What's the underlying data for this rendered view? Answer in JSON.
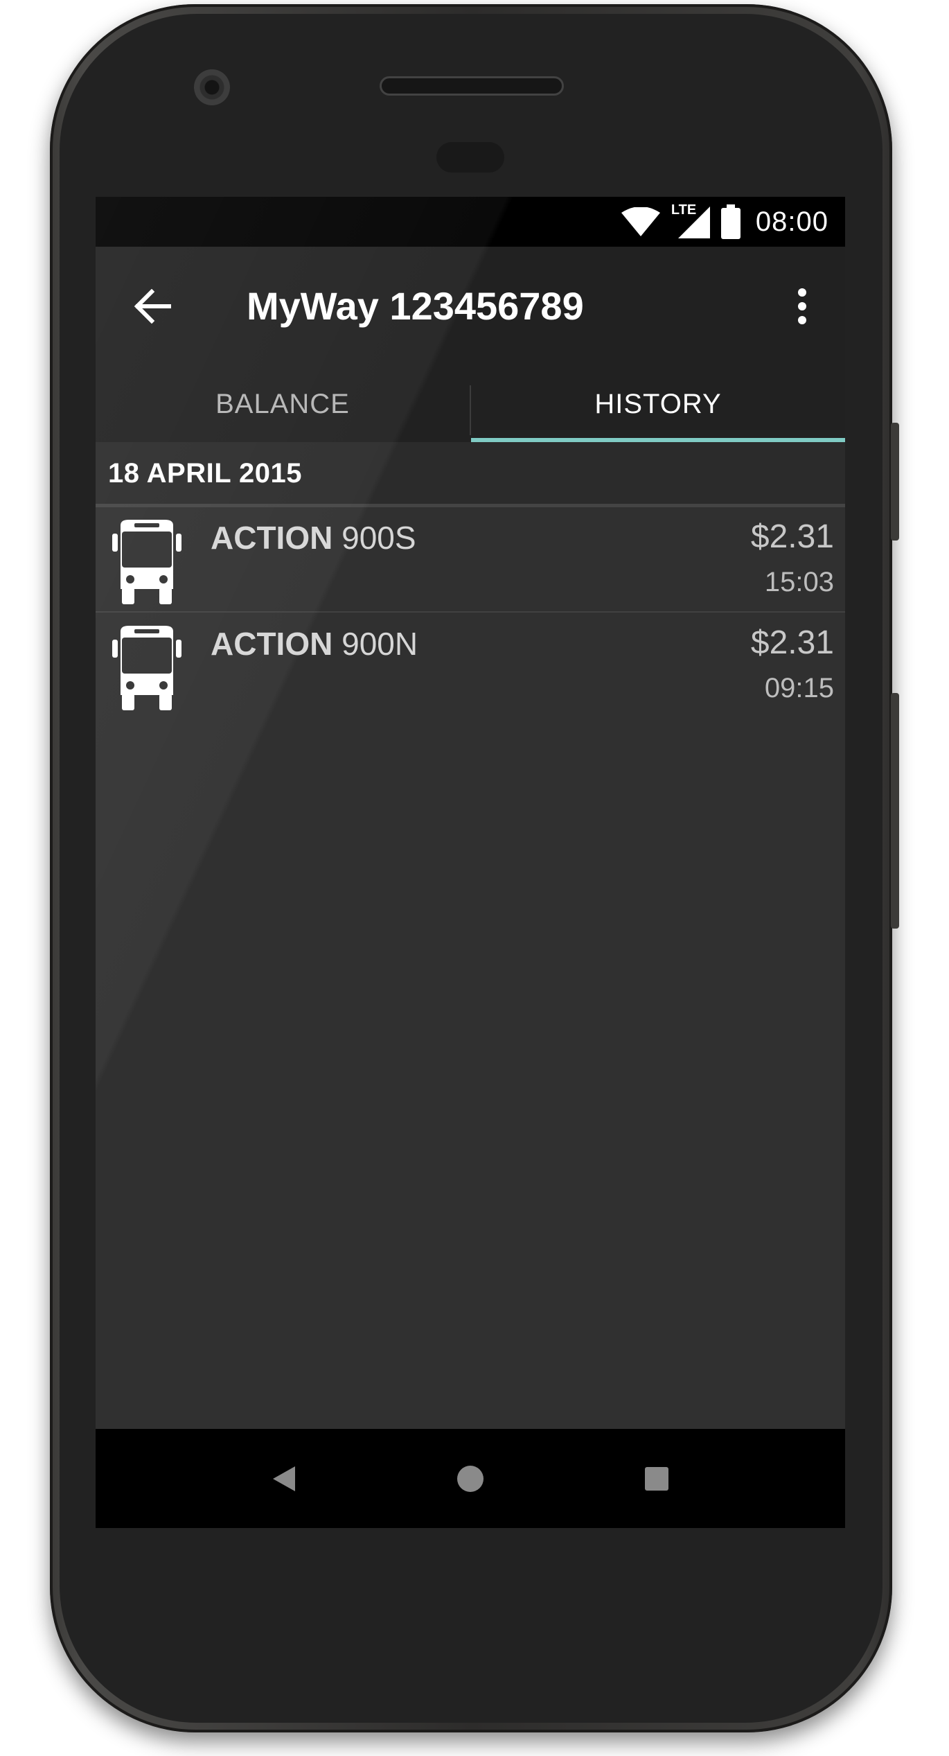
{
  "status_bar": {
    "time": "08:00",
    "network": "LTE",
    "icons": [
      "wifi-icon",
      "cell-signal-icon",
      "battery-icon"
    ]
  },
  "app_bar": {
    "title": "MyWay 123456789",
    "icons": [
      "arrow-back-icon",
      "more-vert-icon"
    ]
  },
  "tabs": [
    {
      "label": "BALANCE",
      "selected": false
    },
    {
      "label": "HISTORY",
      "selected": true
    }
  ],
  "history": {
    "date_header": "18 APRIL 2015",
    "trips": [
      {
        "icon": "bus-icon",
        "agency": "ACTION",
        "route": "900S",
        "fare": "$2.31",
        "time": "15:03"
      },
      {
        "icon": "bus-icon",
        "agency": "ACTION",
        "route": "900N",
        "fare": "$2.31",
        "time": "09:15"
      }
    ]
  },
  "nav_bar": {
    "icons": [
      "nav-back-icon",
      "nav-home-icon",
      "nav-recents-icon"
    ]
  },
  "colors": {
    "accent": "#80cbc4",
    "toolbar": "#212121",
    "background": "#303030"
  }
}
